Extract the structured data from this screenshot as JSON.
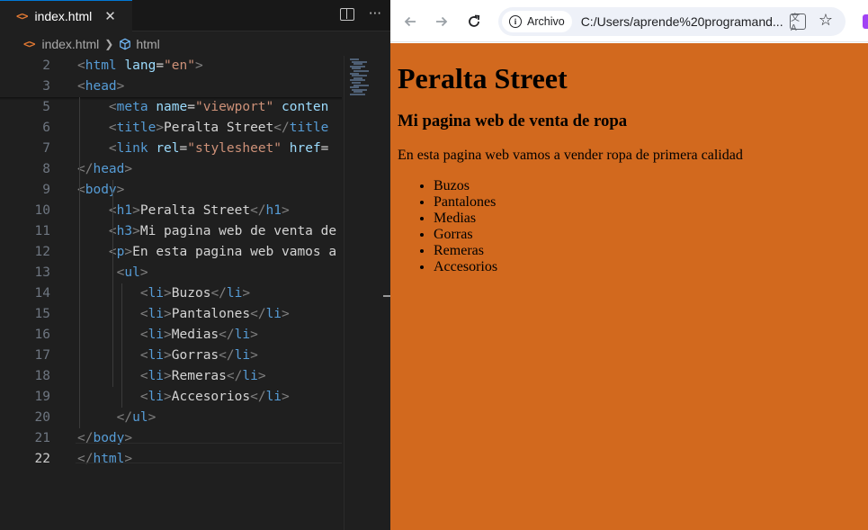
{
  "editor": {
    "tab_label": "index.html",
    "tab_close": "✕",
    "breadcrumb_file": "index.html",
    "breadcrumb_symbol": "html",
    "active_line": 22,
    "lines": [
      {
        "n": "2",
        "html": "<span class=\"punc\">&lt;</span><span class=\"tag\">html</span> <span class=\"attr\">lang</span><span class=\"txt\">=</span><span class=\"str\">\"en\"</span><span class=\"punc\">&gt;</span>"
      },
      {
        "n": "3",
        "html": "<span class=\"punc\">&lt;</span><span class=\"tag\">head</span><span class=\"punc\">&gt;</span>"
      },
      {
        "n": "5",
        "html": "    <span class=\"punc\">&lt;</span><span class=\"tag\">meta</span> <span class=\"attr\">name</span><span class=\"txt\">=</span><span class=\"str\">\"viewport\"</span> <span class=\"attr\">conten</span>"
      },
      {
        "n": "6",
        "html": "    <span class=\"punc\">&lt;</span><span class=\"tag\">title</span><span class=\"punc\">&gt;</span><span class=\"txt\">Peralta Street</span><span class=\"punc\">&lt;/</span><span class=\"tag\">title</span>"
      },
      {
        "n": "7",
        "html": "    <span class=\"punc\">&lt;</span><span class=\"tag\">link</span> <span class=\"attr\">rel</span><span class=\"txt\">=</span><span class=\"str\">\"stylesheet\"</span> <span class=\"attr\">href</span><span class=\"txt\">=</span>"
      },
      {
        "n": "8",
        "html": "<span class=\"punc\">&lt;/</span><span class=\"tag\">head</span><span class=\"punc\">&gt;</span>"
      },
      {
        "n": "9",
        "html": "<span class=\"punc\">&lt;</span><span class=\"tag\">body</span><span class=\"punc\">&gt;</span>"
      },
      {
        "n": "10",
        "html": "    <span class=\"punc\">&lt;</span><span class=\"tag\">h1</span><span class=\"punc\">&gt;</span><span class=\"txt\">Peralta Street</span><span class=\"punc\">&lt;/</span><span class=\"tag\">h1</span><span class=\"punc\">&gt;</span>"
      },
      {
        "n": "11",
        "html": "    <span class=\"punc\">&lt;</span><span class=\"tag\">h3</span><span class=\"punc\">&gt;</span><span class=\"txt\">Mi pagina web de venta de</span>"
      },
      {
        "n": "12",
        "html": "    <span class=\"punc\">&lt;</span><span class=\"tag\">p</span><span class=\"punc\">&gt;</span><span class=\"txt\">En esta pagina web vamos a</span>"
      },
      {
        "n": "13",
        "html": "     <span class=\"punc\">&lt;</span><span class=\"tag\">ul</span><span class=\"punc\">&gt;</span>"
      },
      {
        "n": "14",
        "html": "        <span class=\"punc\">&lt;</span><span class=\"tag\">li</span><span class=\"punc\">&gt;</span><span class=\"txt\">Buzos</span><span class=\"punc\">&lt;/</span><span class=\"tag\">li</span><span class=\"punc\">&gt;</span>"
      },
      {
        "n": "15",
        "html": "        <span class=\"punc\">&lt;</span><span class=\"tag\">li</span><span class=\"punc\">&gt;</span><span class=\"txt\">Pantalones</span><span class=\"punc\">&lt;/</span><span class=\"tag\">li</span><span class=\"punc\">&gt;</span>"
      },
      {
        "n": "16",
        "html": "        <span class=\"punc\">&lt;</span><span class=\"tag\">li</span><span class=\"punc\">&gt;</span><span class=\"txt\">Medias</span><span class=\"punc\">&lt;/</span><span class=\"tag\">li</span><span class=\"punc\">&gt;</span>"
      },
      {
        "n": "17",
        "html": "        <span class=\"punc\">&lt;</span><span class=\"tag\">li</span><span class=\"punc\">&gt;</span><span class=\"txt\">Gorras</span><span class=\"punc\">&lt;/</span><span class=\"tag\">li</span><span class=\"punc\">&gt;</span>"
      },
      {
        "n": "18",
        "html": "        <span class=\"punc\">&lt;</span><span class=\"tag\">li</span><span class=\"punc\">&gt;</span><span class=\"txt\">Remeras</span><span class=\"punc\">&lt;/</span><span class=\"tag\">li</span><span class=\"punc\">&gt;</span>"
      },
      {
        "n": "19",
        "html": "        <span class=\"punc\">&lt;</span><span class=\"tag\">li</span><span class=\"punc\">&gt;</span><span class=\"txt\">Accesorios</span><span class=\"punc\">&lt;/</span><span class=\"tag\">li</span><span class=\"punc\">&gt;</span>"
      },
      {
        "n": "20",
        "html": "     <span class=\"punc\">&lt;/</span><span class=\"tag\">ul</span><span class=\"punc\">&gt;</span>"
      },
      {
        "n": "21",
        "html": "<span class=\"punc\">&lt;/</span><span class=\"tag\">body</span><span class=\"punc\">&gt;</span>"
      },
      {
        "n": "22",
        "html": "<span class=\"punc\">&lt;/</span><span class=\"tag\">html</span><span class=\"punc\">&gt;</span>"
      }
    ]
  },
  "browser": {
    "chip_label": "Archivo",
    "url": "C:/Users/aprende%20programand...",
    "translate_glyph": "文A",
    "page": {
      "h1": "Peralta Street",
      "h3": "Mi pagina web de venta de ropa",
      "p": "En esta pagina web vamos a vender ropa de primera calidad",
      "items": [
        "Buzos",
        "Pantalones",
        "Medias",
        "Gorras",
        "Remeras",
        "Accesorios"
      ]
    }
  },
  "colors": {
    "page_background": "#d2691e",
    "editor_background": "#1f1f1f",
    "tag": "#569cd6",
    "attribute": "#9cdcfe",
    "string": "#ce9178",
    "html_icon": "#e37933"
  },
  "icons": [
    "html-file-icon",
    "close-icon",
    "split-editor-icon",
    "more-icon",
    "chevron-right-icon",
    "symbol-cube-icon",
    "back-arrow-icon",
    "forward-arrow-icon",
    "reload-icon",
    "info-icon",
    "translate-icon",
    "star-icon"
  ]
}
